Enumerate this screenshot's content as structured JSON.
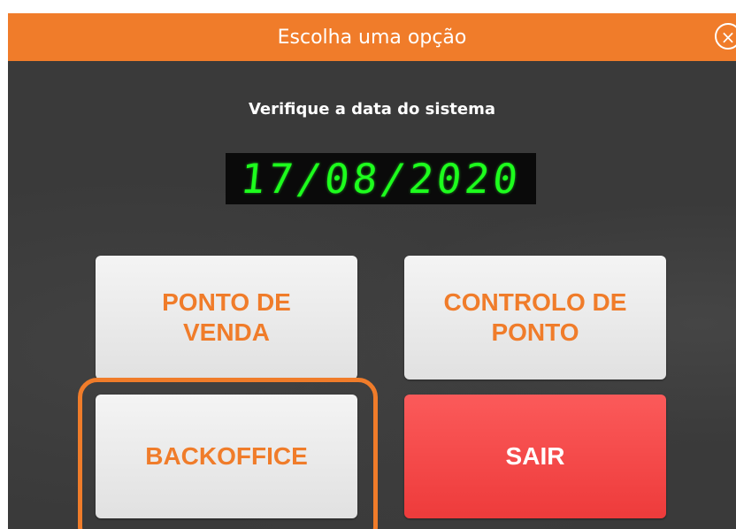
{
  "dialog": {
    "title": "Escolha uma opção",
    "close_icon": "×"
  },
  "date_prompt": "Verifique a data do sistema",
  "system_date": "17/08/2020",
  "buttons": {
    "ponto_de_venda": {
      "line1": "PONTO DE",
      "line2": "VENDA"
    },
    "controlo_de_ponto": {
      "line1": "CONTROLO DE",
      "line2": "PONTO"
    },
    "backoffice": "BACKOFFICE",
    "sair": "SAIR"
  },
  "colors": {
    "accent": "#f07c2a",
    "background": "#3a3a3a",
    "lcd_text": "#1dff1d",
    "danger": "#ee3b3b"
  }
}
